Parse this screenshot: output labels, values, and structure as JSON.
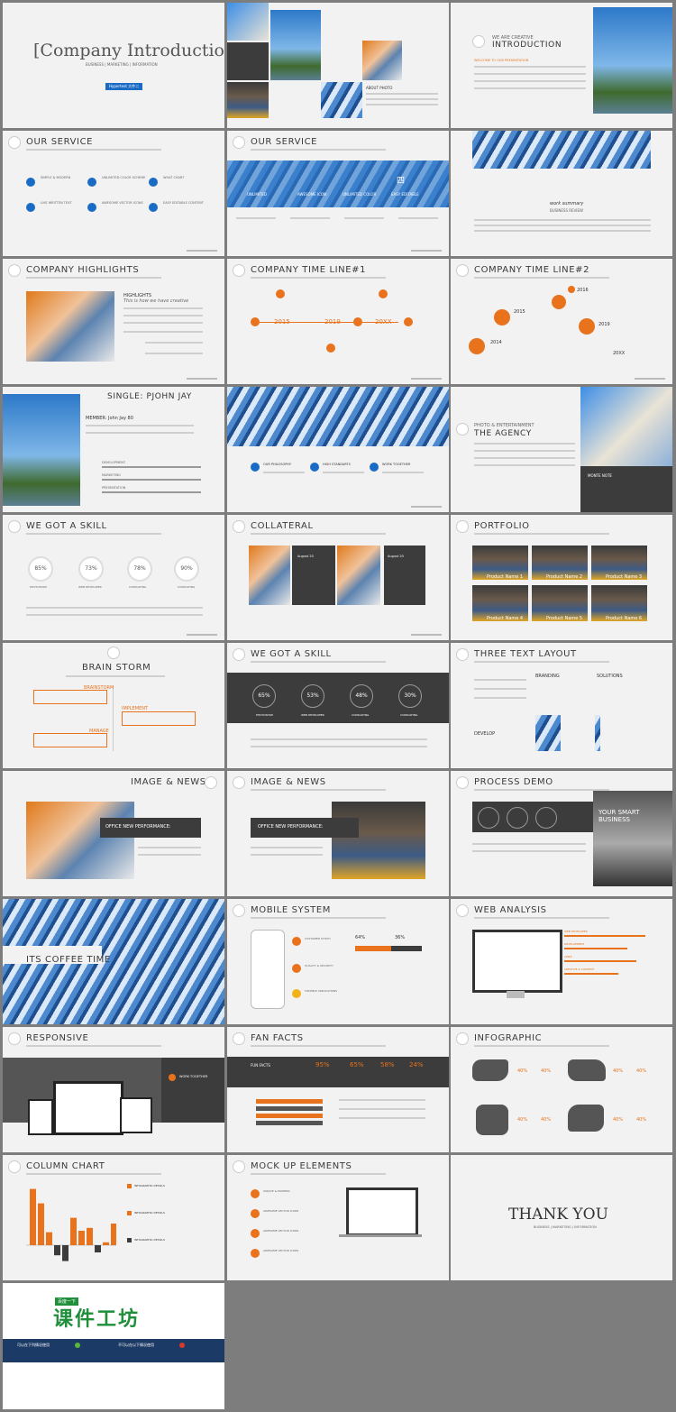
{
  "colors": {
    "accent": "#e8731c",
    "brand_blue": "#1a6bc6",
    "dark": "#3c3c3c",
    "background": "#7d7d7d"
  },
  "slide1": {
    "title": "[Company Introduction",
    "subtitle": "BUSINESS | MARKETING | INFORMATION",
    "tag": "Hypertext 大件二"
  },
  "slide2": {
    "caption": "ABOUT PHOTO"
  },
  "slide3": {
    "kicker": "WE ARE CREATIVE",
    "title": "INTRODUCTION",
    "label": "WELCOME TO OUR PRESENTATION"
  },
  "slide4": {
    "title": "OUR SERVICE",
    "items": [
      "SIMPLE & MODERN",
      "UNLIMITED COLOR SCHEME",
      "WHAT CHART",
      "LIVE WRITTEN TEXT",
      "AWESOME VECTOR ICONS",
      "EASY EDITABLE CONTENT"
    ]
  },
  "slide5": {
    "title": "OUR SERVICE",
    "tabs": [
      "UNLIMITED",
      "AWESOME ICON",
      "UNLIMITED COLOR",
      "EASY EDITABLE"
    ],
    "glyph": "四"
  },
  "slide6": {
    "title": "work summary",
    "subtitle": "BUSINESS REVIEW"
  },
  "slide7": {
    "title": "COMPANY HIGHLIGHTS",
    "heading": "HIGHLIGHTS",
    "sub": "This is how we have creative"
  },
  "slide8": {
    "title": "COMPANY TIME LINE#1",
    "years": [
      "2015",
      "2019",
      "20XX"
    ]
  },
  "slide9": {
    "title": "COMPANY TIME LINE#2",
    "years": [
      "2014",
      "2015",
      "2016",
      "2019",
      "20XX"
    ]
  },
  "slide10": {
    "title": "SINGLE: PJOHN JAY",
    "member": "MEMBER: John Jay 80",
    "bars": [
      "DEVELOPMENT",
      "MARKETING",
      "PRESENTATION"
    ]
  },
  "slide11": {
    "items": [
      "OUR PHILOSOPHY",
      "HIGH STANDARTS",
      "WORK TOGETHER"
    ]
  },
  "slide12": {
    "kicker": "PHOTO & ENTERTAINMENT",
    "title": "THE AGENCY",
    "note": "MONTE NOTE"
  },
  "slide13": {
    "title": "WE GOT A SKILL",
    "values": [
      "85%",
      "73%",
      "78%",
      "90%"
    ],
    "labels": [
      "PHOTOSHOP",
      "WEB DEVELOPER",
      "CONSULTING",
      "CONSULTING"
    ]
  },
  "slide14": {
    "title": "COLLATERAL",
    "cards": [
      "August 20",
      "August 20"
    ]
  },
  "slide15": {
    "title": "PORTFOLIO",
    "items": [
      "Product Name 1",
      "Product Name 2",
      "Product Name 3",
      "Product Name 4",
      "Product Name 5",
      "Product Name 6"
    ]
  },
  "slide16": {
    "title": "BRAIN STORM",
    "items": [
      "BRAINSTORM",
      "IMPLEMENT",
      "MANAGE"
    ]
  },
  "slide17": {
    "title": "WE GOT A SKILL",
    "values": [
      "65%",
      "53%",
      "48%",
      "30%"
    ],
    "labels": [
      "PHOTOSHOP",
      "WEB DEVELOPER",
      "CONSULTING",
      "CONSULTING"
    ]
  },
  "slide18": {
    "title": "THREE TEXT LAYOUT",
    "cols": [
      "BRANDING",
      "SOLUTIONS",
      "DEVELOP"
    ]
  },
  "slide19": {
    "title": "IMAGE & NEWS",
    "banner": "OFFICE NEW PERFORMANCE:"
  },
  "slide20": {
    "title": "IMAGE & NEWS",
    "banner": "OFFICE NEW PERFORMANCE:"
  },
  "slide21": {
    "title": "PROCESS DEMO",
    "side": "YOUR SMART BUSINESS"
  },
  "slide22": {
    "title": "ITS COFFEE TIME"
  },
  "slide23": {
    "title": "MOBILE SYSTEM",
    "items": [
      "CUSTOMER STITCH",
      "QUALITY & SECURITY",
      "FLEXIBLE APPLICATIONS"
    ],
    "stats": [
      "64%",
      "36%"
    ]
  },
  "slide24": {
    "title": "WEB ANALYSIS",
    "bars": [
      "WEB DEVELOPER",
      "DEVELOPMENT",
      "LINKS",
      "CREATIVE & CONTENT"
    ]
  },
  "slide25": {
    "title": "RESPONSIVE",
    "label": "WORK TOGETHER"
  },
  "slide26": {
    "title": "FAN FACTS",
    "label": "FUN FACTS",
    "values": [
      "95%",
      "65%",
      "58%",
      "24%"
    ]
  },
  "slide27": {
    "title": "INFOGRAPHIC",
    "values": [
      "40%",
      "40%",
      "40%",
      "40%",
      "40%",
      "40%",
      "40%",
      "40%"
    ]
  },
  "slide28": {
    "title": "COLUMN CHART",
    "labels": [
      "INFOGRAPHIC DETAILS",
      "INFOGRAPHIC DETAILS",
      "INFOGRAPHIC DETAILS"
    ]
  },
  "chart_data": {
    "type": "bar",
    "values": [
      78,
      58,
      18,
      -14,
      -22,
      38,
      20,
      24,
      -10,
      4,
      30
    ],
    "title": "COLUMN CHART"
  },
  "slide29": {
    "title": "MOCK UP ELEMENTS",
    "items": [
      "UNIQUE & MODERN",
      "AWESOME VECTOR ICONS",
      "AWESOME VECTOR ICONS",
      "AWESOME VECTOR ICONS"
    ]
  },
  "slide30": {
    "title": "THANK YOU",
    "subtitle": "BUSINESS | MARKETING | INFORMATION"
  },
  "promo": {
    "tag": "百度一下",
    "brand": "课件工坊",
    "left": "可以在下列情况使用",
    "right": "不可以在以下情况使用"
  }
}
